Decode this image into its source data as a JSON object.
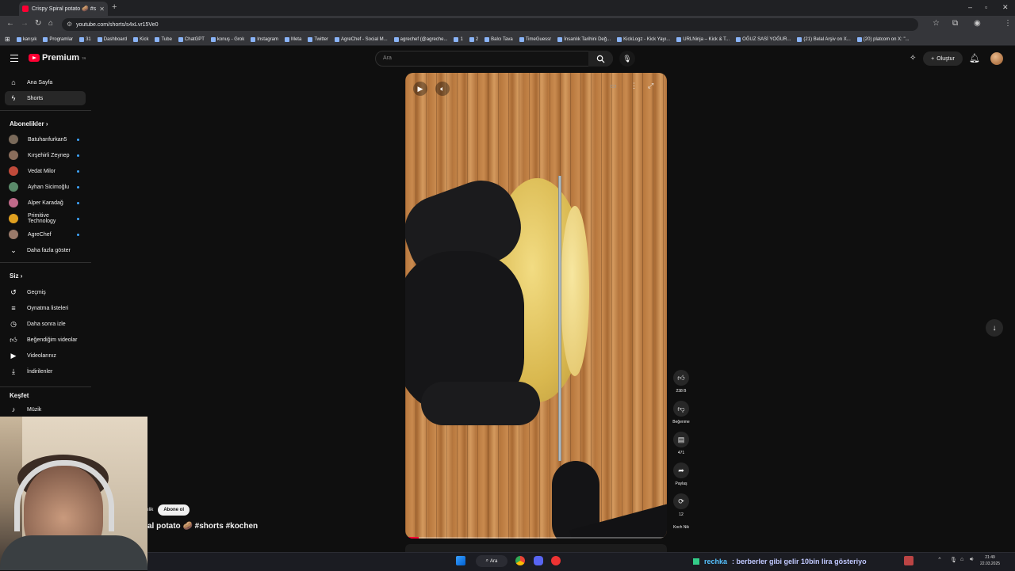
{
  "browser": {
    "tab_title": "Crispy Spiral potato 🥔 #shorts",
    "url": "youtube.com/shorts/s4xLvr15Ve0",
    "bookmarks": [
      "karışık",
      "Programlar",
      "31",
      "Dashboard",
      "Kick",
      "Tube",
      "ChatGPT",
      "konuş - Grok",
      "Instagram",
      "Meta",
      "Twitter",
      "AgreChef - Social M...",
      "agrechef (@agreche...",
      "1",
      "2",
      "Balcı Tava",
      "TimeGuessr",
      "İnsanlık Tarihini Değ...",
      "KickLogz - Kick Yayı...",
      "URLNinja – Kick & T...",
      "OĞUZ SASİ YOĞUR...",
      "(21) Belal Arşiv on X...",
      "(20) platcom on X: \"..."
    ]
  },
  "header": {
    "logo_text": "Premium",
    "logo_sup": "TR",
    "search_placeholder": "Ara",
    "create_label": "Oluştur"
  },
  "sidebar": {
    "home_label": "Ana Sayfa",
    "shorts_label": "Shorts",
    "subscriptions_title": "Abonelikler",
    "subscriptions": [
      {
        "name": "Batuhanfurkan5",
        "color": "#7a6a5a"
      },
      {
        "name": "Kırşehirli Zeynep",
        "color": "#8a6d5b"
      },
      {
        "name": "Vedat Milor",
        "color": "#c04a3a"
      },
      {
        "name": "Ayhan Sicimoğlu",
        "color": "#5a8a6a"
      },
      {
        "name": "Alper Karadağ",
        "color": "#c06a8a"
      },
      {
        "name": "Primitive Technology",
        "color": "#e0a020"
      },
      {
        "name": "AgreChef",
        "color": "#9a7a6a"
      }
    ],
    "show_more_label": "Daha fazla göster",
    "you_title": "Siz",
    "you_items": [
      "Geçmiş",
      "Oynatma listeleri",
      "Daha sonra izle",
      "Beğendiğim videolar",
      "Videolarınız",
      "İndirilenler"
    ],
    "explore_title": "Keşfet",
    "explore_items": [
      "Müzik"
    ]
  },
  "short": {
    "progress": 0.05,
    "channel_partial": "ılik",
    "subscribe_label": "Abone ol",
    "title_partial": "al potato 🥔 #shorts #kochen"
  },
  "actions": {
    "like_count": "238 B",
    "dislike_label": "Beğenme",
    "comment_count": "471",
    "share_label": "Paylaş",
    "remix_count": "12",
    "sound_label": "Koch Nik"
  },
  "taskbar": {
    "search_label": "Ara",
    "ticker_user": "rechka",
    "ticker_message": ": berberler gibi gelir 10bin lira gösteriyo",
    "time": "21:49",
    "date": "22.03.2025"
  }
}
